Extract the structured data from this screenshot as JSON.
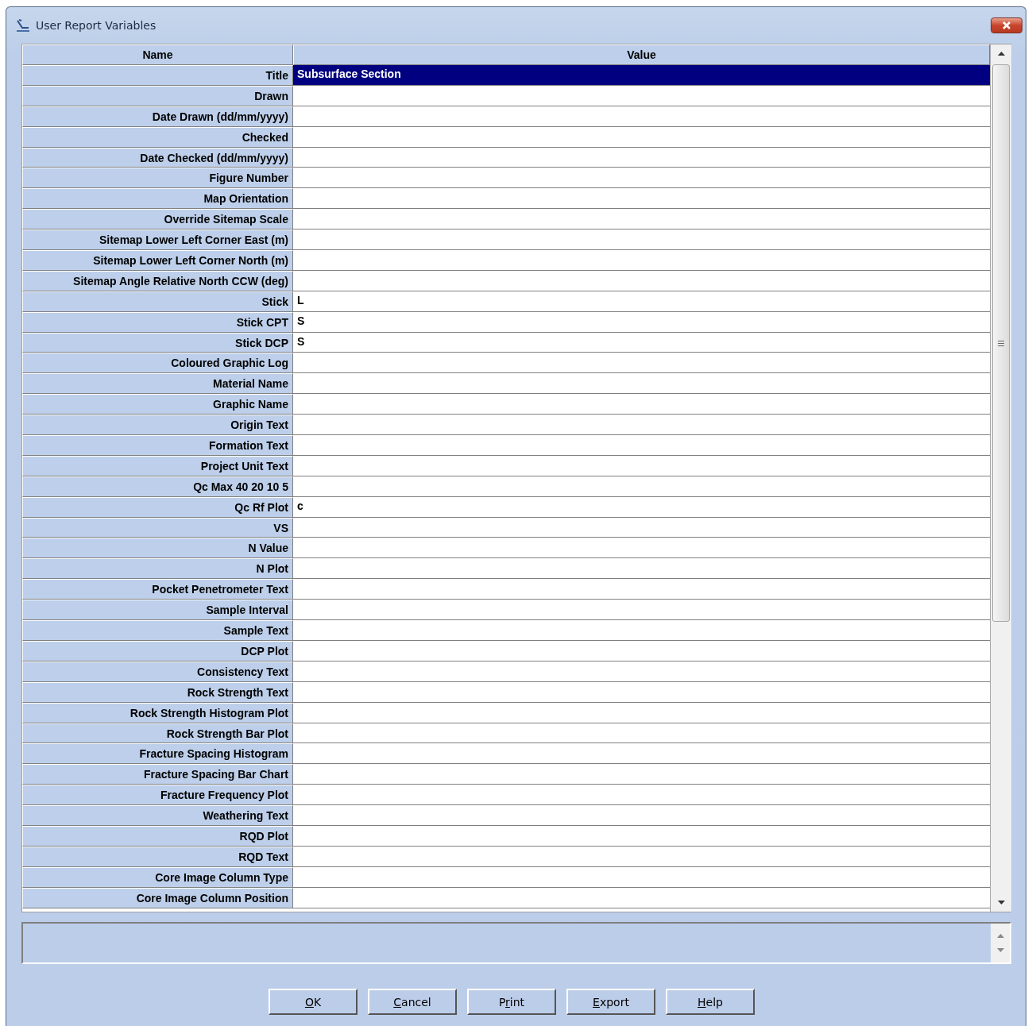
{
  "window": {
    "title": "User Report Variables"
  },
  "table": {
    "columns": [
      "Name",
      "Value"
    ],
    "rows": [
      {
        "name": "Title",
        "value": "Subsurface Section",
        "selected": true
      },
      {
        "name": "Drawn",
        "selected": false
      },
      {
        "name": "Date Drawn (dd/mm/yyyy)",
        "selected": false
      },
      {
        "name": "Checked",
        "selected": false
      },
      {
        "name": "Date Checked (dd/mm/yyyy)",
        "selected": false
      },
      {
        "name": "Figure Number",
        "selected": false
      },
      {
        "name": "Map Orientation",
        "selected": false
      },
      {
        "name": "Override Sitemap Scale",
        "selected": false
      },
      {
        "name": "Sitemap Lower Left Corner East (m)",
        "selected": false
      },
      {
        "name": "Sitemap Lower Left Corner North (m)",
        "selected": false
      },
      {
        "name": "Sitemap Angle Relative North CCW (deg)",
        "selected": false
      },
      {
        "name": "Stick",
        "value": "L",
        "selected": false
      },
      {
        "name": "Stick CPT",
        "value": "S",
        "selected": false
      },
      {
        "name": "Stick DCP",
        "value": "S",
        "selected": false
      },
      {
        "name": "Coloured Graphic Log",
        "selected": false
      },
      {
        "name": "Material Name",
        "selected": false
      },
      {
        "name": "Graphic Name",
        "selected": false
      },
      {
        "name": "Origin Text",
        "selected": false
      },
      {
        "name": "Formation Text",
        "selected": false
      },
      {
        "name": "Project Unit Text",
        "selected": false
      },
      {
        "name": "Qc Max 40 20 10 5",
        "selected": false
      },
      {
        "name": "Qc Rf Plot",
        "value": "c",
        "selected": false
      },
      {
        "name": "VS",
        "selected": false
      },
      {
        "name": "N Value",
        "selected": false
      },
      {
        "name": "N Plot",
        "selected": false
      },
      {
        "name": "Pocket Penetrometer Text",
        "selected": false
      },
      {
        "name": "Sample Interval",
        "selected": false
      },
      {
        "name": "Sample Text",
        "selected": false
      },
      {
        "name": "DCP Plot",
        "selected": false
      },
      {
        "name": "Consistency Text",
        "selected": false
      },
      {
        "name": "Rock Strength Text",
        "selected": false
      },
      {
        "name": "Rock Strength Histogram Plot",
        "selected": false
      },
      {
        "name": "Rock Strength Bar Plot",
        "selected": false
      },
      {
        "name": "Fracture Spacing Histogram",
        "selected": false
      },
      {
        "name": "Fracture Spacing Bar Chart",
        "selected": false
      },
      {
        "name": "Fracture Frequency Plot",
        "selected": false
      },
      {
        "name": "Weathering Text",
        "selected": false
      },
      {
        "name": "RQD Plot",
        "selected": false
      },
      {
        "name": "RQD Text",
        "selected": false
      },
      {
        "name": "Core Image Column Type",
        "selected": false
      },
      {
        "name": "Core Image Column Position",
        "selected": false
      }
    ]
  },
  "buttons": [
    {
      "key": "O",
      "after": "K"
    },
    {
      "key": "C",
      "after": "ancel"
    },
    {
      "before": "P",
      "key": "r",
      "after": "int"
    },
    {
      "key": "E",
      "after": "xport"
    },
    {
      "key": "H",
      "after": "elp"
    }
  ]
}
